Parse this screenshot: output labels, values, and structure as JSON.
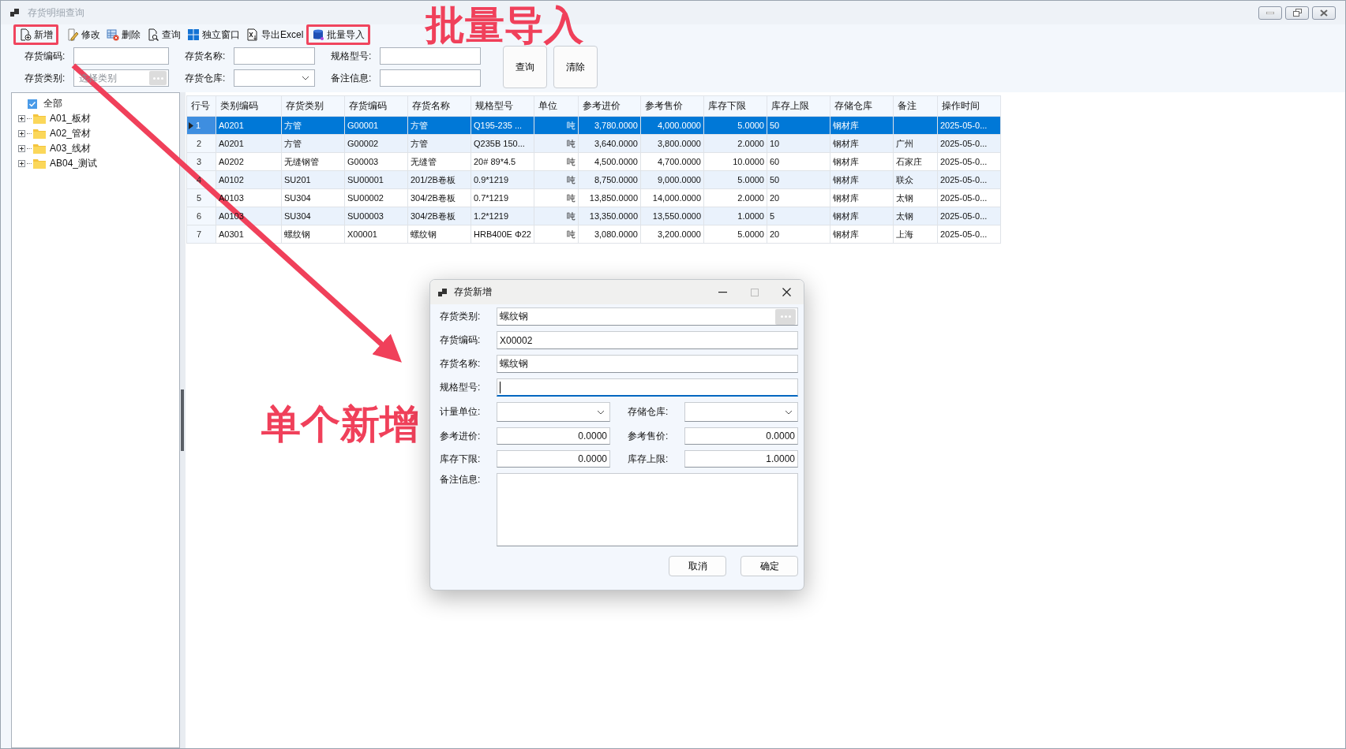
{
  "window": {
    "title": "存货明细查询"
  },
  "toolbar": [
    {
      "label": "新增",
      "highlighted": true
    },
    {
      "label": "修改",
      "highlighted": false
    },
    {
      "label": "删除",
      "highlighted": false
    },
    {
      "label": "查询",
      "highlighted": false
    },
    {
      "label": "独立窗口",
      "highlighted": false
    },
    {
      "label": "导出Excel",
      "highlighted": false
    },
    {
      "label": "批量导入",
      "highlighted": true
    }
  ],
  "filters": [
    {
      "label": "存货编码:",
      "kind": "text"
    },
    {
      "label": "存货名称:",
      "kind": "text"
    },
    {
      "label": "规格型号:",
      "kind": "text"
    },
    {
      "label": "存货类别:",
      "kind": "picker",
      "placeholder": "选择类别"
    },
    {
      "label": "存货仓库:",
      "kind": "select"
    },
    {
      "label": "备注信息:",
      "kind": "text"
    }
  ],
  "filter_buttons": [
    "查询",
    "清除"
  ],
  "tree": {
    "label": "全部",
    "checked": true,
    "children": [
      {
        "label": "A01_板材",
        "expanded": false
      },
      {
        "label": "A02_管材",
        "expanded": false
      },
      {
        "label": "A03_线材",
        "expanded": false
      },
      {
        "label": "AB04_测试",
        "expanded": false
      }
    ]
  },
  "table": {
    "columns": [
      "行号",
      "类别编码",
      "存货类别",
      "存货编码",
      "存货名称",
      "规格型号",
      "单位",
      "参考进价",
      "参考售价",
      "库存下限",
      "库存上限",
      "存储仓库",
      "备注",
      "操作时间"
    ],
    "rows": [
      {
        "selected": true,
        "cells": [
          "1",
          "A0201",
          "方管",
          "G00001",
          "方管",
          "Q195-235 ...",
          "吨",
          "3,780.0000",
          "4,000.0000",
          "5.0000",
          "50",
          "钢材库",
          "",
          "2025-05-0..."
        ]
      },
      {
        "selected": false,
        "cells": [
          "2",
          "A0201",
          "方管",
          "G00002",
          "方管",
          "Q235B 150...",
          "吨",
          "3,640.0000",
          "3,800.0000",
          "2.0000",
          "10",
          "钢材库",
          "广州",
          "2025-05-0..."
        ]
      },
      {
        "selected": false,
        "cells": [
          "3",
          "A0202",
          "无缝钢管",
          "G00003",
          "无缝管",
          "20# 89*4.5",
          "吨",
          "4,500.0000",
          "4,700.0000",
          "10.0000",
          "60",
          "钢材库",
          "石家庄",
          "2025-05-0..."
        ]
      },
      {
        "selected": false,
        "cells": [
          "4",
          "A0102",
          "SU201",
          "SU00001",
          "201/2B卷板",
          "0.9*1219",
          "吨",
          "8,750.0000",
          "9,000.0000",
          "5.0000",
          "50",
          "钢材库",
          "联众",
          "2025-05-0..."
        ]
      },
      {
        "selected": false,
        "cells": [
          "5",
          "A0103",
          "SU304",
          "SU00002",
          "304/2B卷板",
          "0.7*1219",
          "吨",
          "13,850.0000",
          "14,000.0000",
          "2.0000",
          "20",
          "钢材库",
          "太钢",
          "2025-05-0..."
        ]
      },
      {
        "selected": false,
        "cells": [
          "6",
          "A0103",
          "SU304",
          "SU00003",
          "304/2B卷板",
          "1.2*1219",
          "吨",
          "13,350.0000",
          "13,550.0000",
          "1.0000",
          "5",
          "钢材库",
          "太钢",
          "2025-05-0..."
        ]
      },
      {
        "selected": false,
        "cells": [
          "7",
          "A0301",
          "螺纹钢",
          "X00001",
          "螺纹钢",
          "HRB400E Φ22",
          "吨",
          "3,080.0000",
          "3,200.0000",
          "5.0000",
          "20",
          "钢材库",
          "上海",
          "2025-05-0..."
        ]
      }
    ]
  },
  "dialog": {
    "title": "存货新增",
    "fields": [
      {
        "label": "存货类别:",
        "kind": "picker",
        "value": "螺纹钢"
      },
      {
        "label": "存货编码:",
        "kind": "text",
        "value": "X00002"
      },
      {
        "label": "存货名称:",
        "kind": "text",
        "value": "螺纹钢"
      },
      {
        "label": "规格型号:",
        "kind": "text",
        "focused": true
      }
    ],
    "pairs": [
      {
        "label": "计量单位:",
        "kind": "select"
      },
      {
        "label": "存储仓库:",
        "kind": "select"
      },
      {
        "label": "参考进价:",
        "kind": "number",
        "value": "0.0000"
      },
      {
        "label": "参考售价:",
        "kind": "number",
        "value": "0.0000"
      },
      {
        "label": "库存下限:",
        "kind": "number",
        "value": "0.0000"
      },
      {
        "label": "库存上限:",
        "kind": "number",
        "value": "1.0000"
      }
    ],
    "remarks": {
      "label": "备注信息:"
    },
    "buttons": [
      "取消",
      "确定"
    ]
  },
  "annotations": [
    "批量导入",
    "单个新增"
  ]
}
